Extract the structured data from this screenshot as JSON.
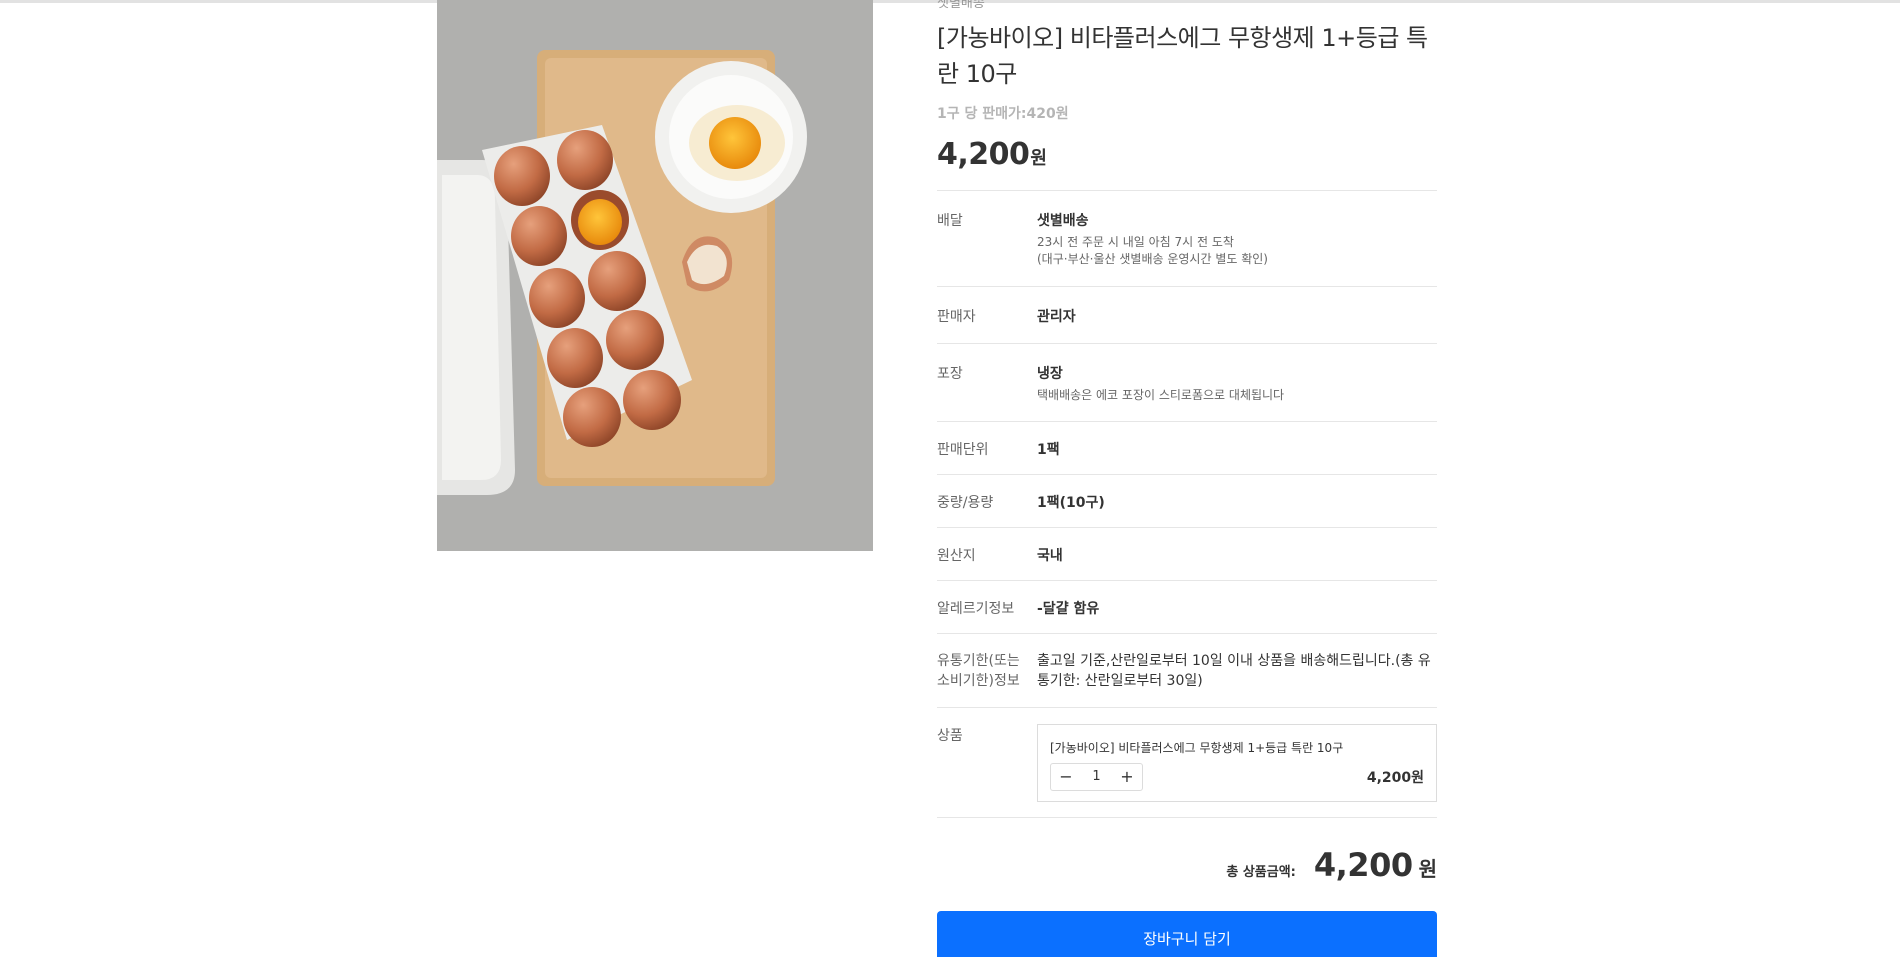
{
  "product": {
    "delivery_tag": "샛별배송",
    "title": "[가농바이오] 비타플러스에그 무항생제 1+등급 특란 10구",
    "unit_price": "1구 당 판매가:420원",
    "price": "4,200",
    "price_unit": "원",
    "image_alt": "eggs-in-carton-photo"
  },
  "details": {
    "delivery": {
      "label": "배달",
      "value": "샛별배송",
      "sub1": "23시 전 주문 시 내일 아침 7시 전 도착",
      "sub2": "(대구·부산·울산 샛별배송 운영시간 별도 확인)"
    },
    "seller": {
      "label": "판매자",
      "value": "관리자"
    },
    "packaging": {
      "label": "포장",
      "value": "냉장",
      "sub": "택배배송은 에코 포장이 스티로폼으로 대체됩니다"
    },
    "unit": {
      "label": "판매단위",
      "value": "1팩"
    },
    "weight": {
      "label": "중량/용량",
      "value": "1팩(10구)"
    },
    "origin": {
      "label": "원산지",
      "value": "국내"
    },
    "allergy": {
      "label": "알레르기정보",
      "value": "-달걀 함유"
    },
    "expiry": {
      "label": "유통기한(또는 소비기한)정보",
      "value": "출고일 기준,산란일로부터 10일 이내 상품을 배송해드립니다.(총 유통기한: 산란일로부터 30일)"
    }
  },
  "option": {
    "label": "상품",
    "name": "[가농바이오] 비타플러스에그 무항생제 1+등급 특란 10구",
    "qty": "1",
    "minus": "−",
    "plus": "+",
    "price": "4,200원"
  },
  "total": {
    "label": "총 상품금액:",
    "amount": "4,200",
    "unit": "원"
  },
  "cart_button": "장바구니 담기",
  "colors": {
    "accent": "#0b70ff",
    "text": "#333333",
    "muted": "#999999",
    "border": "#e6e6e6"
  }
}
